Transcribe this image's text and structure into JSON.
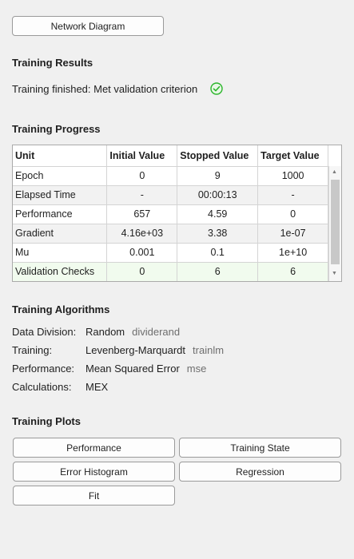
{
  "network_button": "Network Diagram",
  "results": {
    "title": "Training Results",
    "status": "Training finished: Met validation criterion",
    "status_color": "#2bb52b"
  },
  "progress": {
    "title": "Training Progress",
    "columns": [
      "Unit",
      "Initial Value",
      "Stopped Value",
      "Target Value"
    ],
    "rows": [
      [
        "Epoch",
        "0",
        "9",
        "1000"
      ],
      [
        "Elapsed Time",
        "-",
        "00:00:13",
        "-"
      ],
      [
        "Performance",
        "657",
        "4.59",
        "0"
      ],
      [
        "Gradient",
        "4.16e+03",
        "3.38",
        "1e-07"
      ],
      [
        "Mu",
        "0.001",
        "0.1",
        "1e+10"
      ],
      [
        "Validation Checks",
        "0",
        "6",
        "6"
      ]
    ]
  },
  "algorithms": {
    "title": "Training Algorithms",
    "rows": [
      {
        "label": "Data Division:",
        "value": "Random",
        "extra": "dividerand"
      },
      {
        "label": "Training:",
        "value": "Levenberg-Marquardt",
        "extra": "trainlm"
      },
      {
        "label": "Performance:",
        "value": "Mean Squared Error",
        "extra": "mse"
      },
      {
        "label": "Calculations:",
        "value": "MEX",
        "extra": ""
      }
    ]
  },
  "plots": {
    "title": "Training Plots",
    "buttons": [
      "Performance",
      "Training State",
      "Error Histogram",
      "Regression",
      "Fit"
    ]
  }
}
